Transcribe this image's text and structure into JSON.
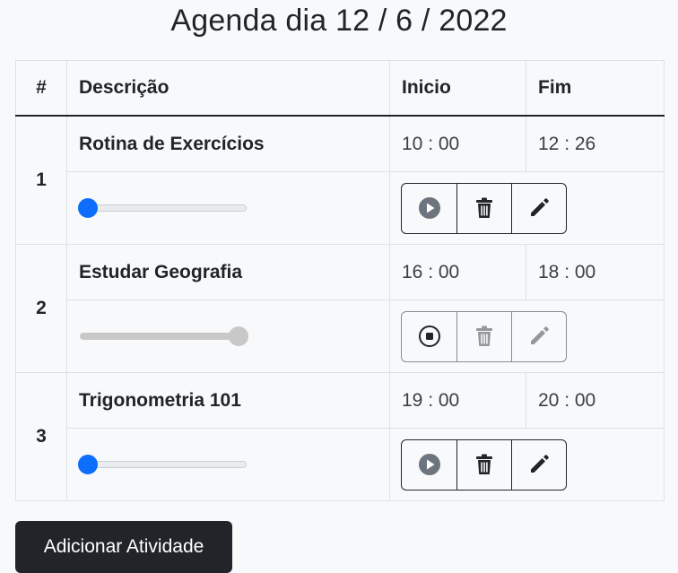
{
  "page": {
    "title": "Agenda dia 12 / 6 / 2022"
  },
  "table": {
    "headers": {
      "num": "#",
      "desc": "Descrição",
      "inicio": "Inicio",
      "fim": "Fim"
    },
    "rows": [
      {
        "num": "1",
        "desc": "Rotina de Exercícios",
        "inicio": "10 : 00",
        "fim": "12 : 26",
        "progress": 0,
        "state": "stopped",
        "status_icon": "play-icon"
      },
      {
        "num": "2",
        "desc": "Estudar Geografia",
        "inicio": "16 : 00",
        "fim": "18 : 00",
        "progress": 1,
        "state": "running",
        "status_icon": "stop-icon"
      },
      {
        "num": "3",
        "desc": "Trigonometria 101",
        "inicio": "19 : 00",
        "fim": "20 : 00",
        "progress": 0,
        "state": "stopped",
        "status_icon": "play-icon"
      }
    ]
  },
  "actions": {
    "add_label": "Adicionar Atividade"
  },
  "colors": {
    "accent": "#0d6efd",
    "dark": "#212529",
    "background": "#f8f9fa"
  }
}
